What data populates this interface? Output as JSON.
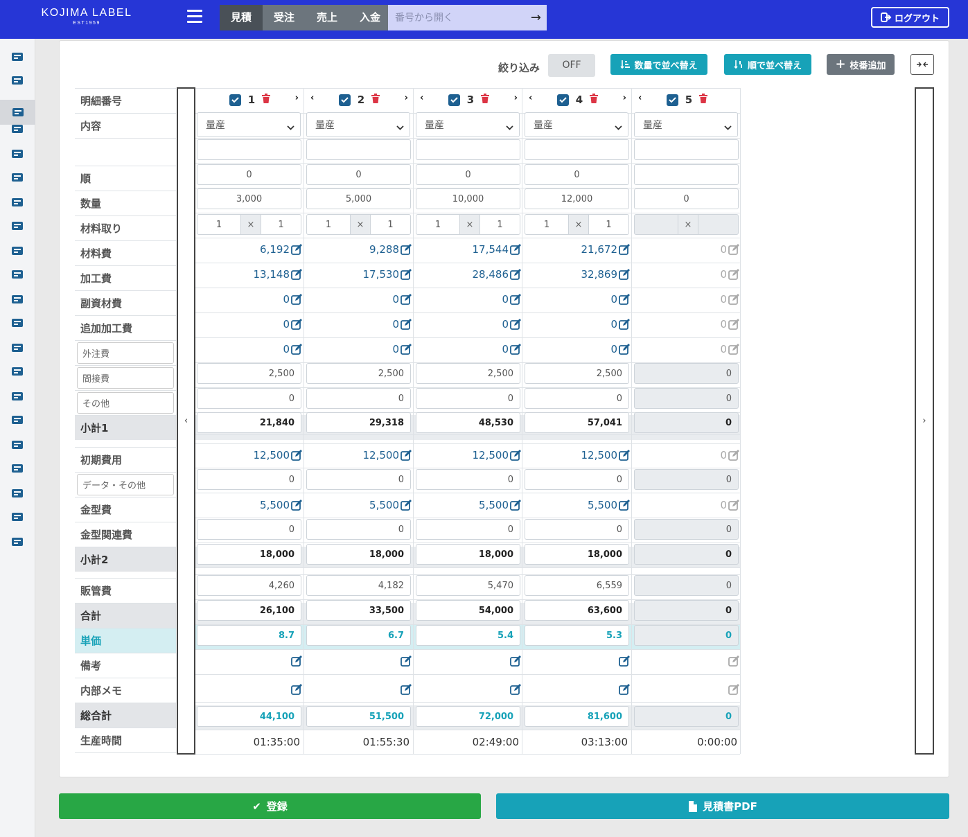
{
  "header": {
    "logo": "KOJIMA LABEL",
    "logo_sub": "EST1959",
    "tabs": [
      "見積",
      "受注",
      "売上",
      "入金"
    ],
    "search_placeholder": "番号から開く",
    "logout": "ログアウト"
  },
  "sidebar_icons": [
    "dashboard-icon",
    "calculator-icon",
    "calculator-icon",
    "inbox-icon",
    "inbox-icon",
    "document-icon",
    "document-icon",
    "truck-icon",
    "money-icon",
    "money-icon",
    "printer-icon",
    "envelope-icon",
    "wallet-icon",
    "chart-icon",
    "id-card-icon",
    "building-icon",
    "calendar-icon",
    "building-icon",
    "database-icon",
    "envelope-icon",
    "gears-icon"
  ],
  "toolbar": {
    "filter_label": "絞り込み",
    "filter_state": "OFF",
    "sort_qty": "数量で並べ替え",
    "sort_order": "順で並べ替え",
    "add_branch": "枝番追加"
  },
  "labels": {
    "detail_no": "明細番号",
    "content": "内容",
    "order": "順",
    "quantity": "数量",
    "material_take": "材料取り",
    "material_cost": "材料費",
    "processing_cost": "加工費",
    "sub_material": "副資材費",
    "additional_processing": "追加加工費",
    "outsourcing": "外注費",
    "indirect": "間接費",
    "other": "その他",
    "subtotal1": "小計1",
    "initial_cost": "初期費用",
    "data_other": "データ・その他",
    "mold_cost": "金型費",
    "mold_related": "金型関連費",
    "subtotal2": "小計2",
    "admin_cost": "販管費",
    "total": "合計",
    "unit_price": "単価",
    "remarks": "備考",
    "internal_memo": "内部メモ",
    "grand_total": "総合計",
    "production_time": "生産時間"
  },
  "columns": [
    {
      "no": "1",
      "content": "量産",
      "name": "",
      "order": "0",
      "quantity": "3,000",
      "take_a": "1",
      "take_b": "1",
      "material": "6,192",
      "processing": "13,148",
      "sub_material": "0",
      "additional": "0",
      "outsourcing": "0",
      "indirect": "2,500",
      "other": "0",
      "subtotal1": "21,840",
      "initial": "12,500",
      "data_other": "0",
      "mold": "5,500",
      "mold_related": "0",
      "subtotal2": "18,000",
      "admin": "4,260",
      "total": "26,100",
      "unit_price": "8.7",
      "grand_total": "44,100",
      "time": "01:35:00",
      "disabled": false
    },
    {
      "no": "2",
      "content": "量産",
      "name": "",
      "order": "0",
      "quantity": "5,000",
      "take_a": "1",
      "take_b": "1",
      "material": "9,288",
      "processing": "17,530",
      "sub_material": "0",
      "additional": "0",
      "outsourcing": "0",
      "indirect": "2,500",
      "other": "0",
      "subtotal1": "29,318",
      "initial": "12,500",
      "data_other": "0",
      "mold": "5,500",
      "mold_related": "0",
      "subtotal2": "18,000",
      "admin": "4,182",
      "total": "33,500",
      "unit_price": "6.7",
      "grand_total": "51,500",
      "time": "01:55:30",
      "disabled": false
    },
    {
      "no": "3",
      "content": "量産",
      "name": "",
      "order": "0",
      "quantity": "10,000",
      "take_a": "1",
      "take_b": "1",
      "material": "17,544",
      "processing": "28,486",
      "sub_material": "0",
      "additional": "0",
      "outsourcing": "0",
      "indirect": "2,500",
      "other": "0",
      "subtotal1": "48,530",
      "initial": "12,500",
      "data_other": "0",
      "mold": "5,500",
      "mold_related": "0",
      "subtotal2": "18,000",
      "admin": "5,470",
      "total": "54,000",
      "unit_price": "5.4",
      "grand_total": "72,000",
      "time": "02:49:00",
      "disabled": false
    },
    {
      "no": "4",
      "content": "量産",
      "name": "",
      "order": "0",
      "quantity": "12,000",
      "take_a": "1",
      "take_b": "1",
      "material": "21,672",
      "processing": "32,869",
      "sub_material": "0",
      "additional": "0",
      "outsourcing": "0",
      "indirect": "2,500",
      "other": "0",
      "subtotal1": "57,041",
      "initial": "12,500",
      "data_other": "0",
      "mold": "5,500",
      "mold_related": "0",
      "subtotal2": "18,000",
      "admin": "6,559",
      "total": "63,600",
      "unit_price": "5.3",
      "grand_total": "81,600",
      "time": "03:13:00",
      "disabled": false
    },
    {
      "no": "5",
      "content": "量産",
      "name": "",
      "order": "",
      "quantity": "0",
      "take_a": "",
      "take_b": "",
      "material": "0",
      "processing": "0",
      "sub_material": "0",
      "additional": "0",
      "outsourcing": "0",
      "indirect": "0",
      "other": "0",
      "subtotal1": "0",
      "initial": "0",
      "data_other": "0",
      "mold": "0",
      "mold_related": "0",
      "subtotal2": "0",
      "admin": "0",
      "total": "0",
      "unit_price": "0",
      "grand_total": "0",
      "time": "0:00:00",
      "disabled": true
    }
  ],
  "footer": {
    "register": "登録",
    "quote_pdf": "見積書PDF"
  },
  "colors": {
    "header": "#2636d6",
    "teal": "#17a2b8",
    "green": "#28a745",
    "link": "#1e6091"
  }
}
